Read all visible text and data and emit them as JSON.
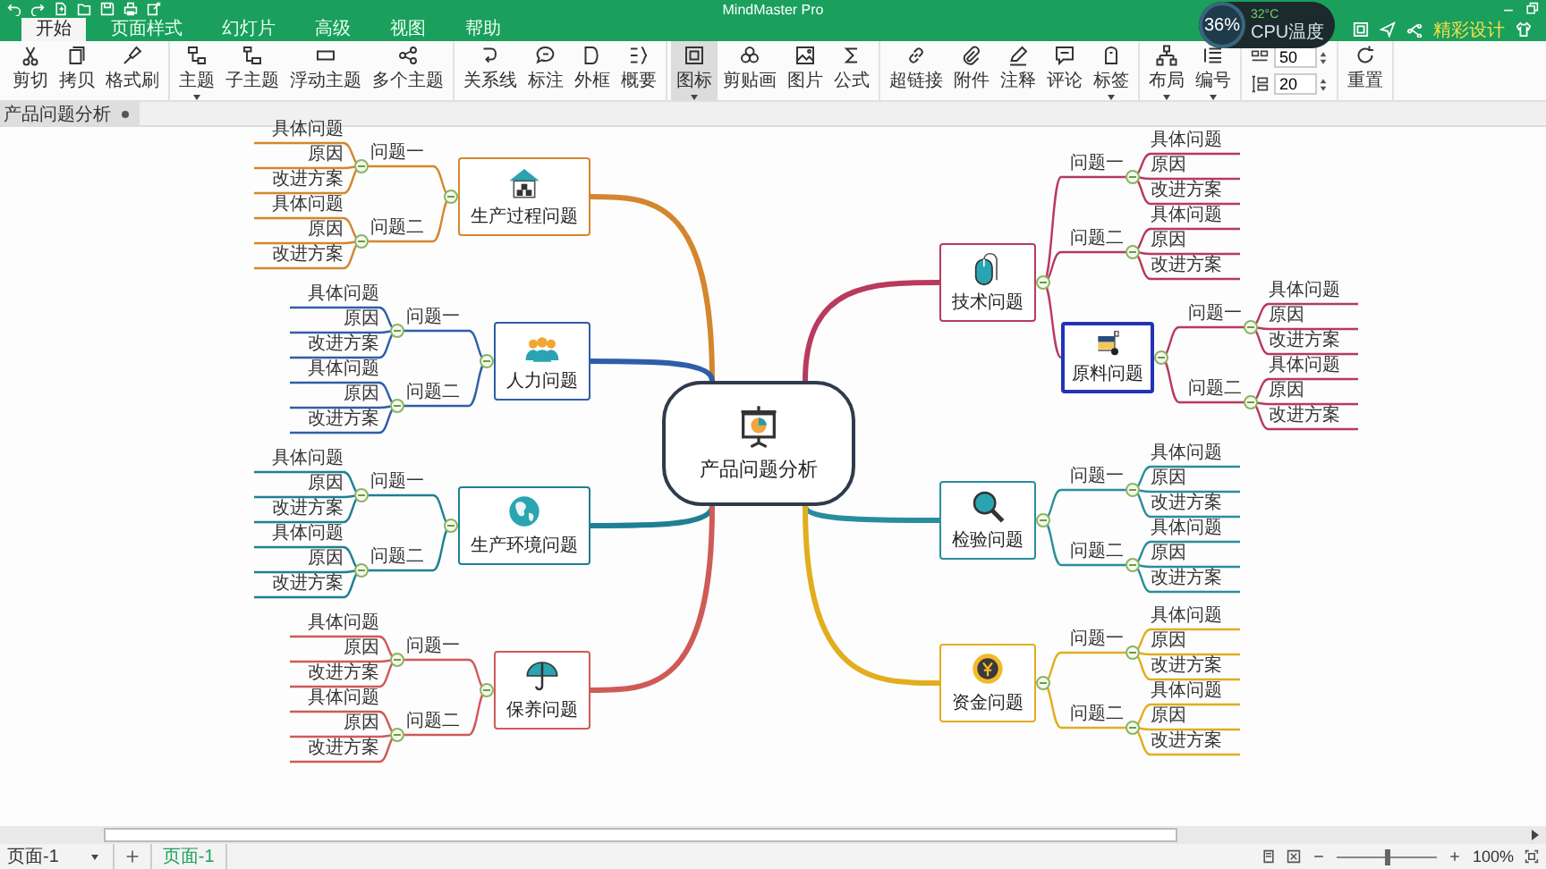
{
  "window": {
    "title": "MindMaster Pro"
  },
  "cpu_widget": {
    "usage": "36%",
    "temperature": "32°C",
    "label": "CPU温度"
  },
  "account": {
    "label": "精彩设计"
  },
  "menu_tabs": [
    {
      "label": "开始",
      "selected": true
    },
    {
      "label": "页面样式",
      "selected": false
    },
    {
      "label": "幻灯片",
      "selected": false
    },
    {
      "label": "高级",
      "selected": false
    },
    {
      "label": "视图",
      "selected": false
    },
    {
      "label": "帮助",
      "selected": false
    }
  ],
  "toolbar": [
    {
      "kind": "buttons",
      "items": [
        {
          "label": "剪切",
          "dropdown": false,
          "selected": false
        },
        {
          "label": "拷贝",
          "dropdown": false,
          "selected": false
        },
        {
          "label": "格式刷",
          "dropdown": false,
          "selected": false
        }
      ]
    },
    {
      "kind": "buttons",
      "items": [
        {
          "label": "主题",
          "dropdown": true,
          "selected": false
        },
        {
          "label": "子主题",
          "dropdown": false,
          "selected": false
        },
        {
          "label": "浮动主题",
          "dropdown": false,
          "selected": false
        },
        {
          "label": "多个主题",
          "dropdown": false,
          "selected": false
        }
      ]
    },
    {
      "kind": "buttons",
      "items": [
        {
          "label": "关系线",
          "dropdown": false,
          "selected": false
        },
        {
          "label": "标注",
          "dropdown": false,
          "selected": false
        },
        {
          "label": "外框",
          "dropdown": false,
          "selected": false
        },
        {
          "label": "概要",
          "dropdown": false,
          "selected": false
        }
      ]
    },
    {
      "kind": "buttons",
      "items": [
        {
          "label": "图标",
          "dropdown": true,
          "selected": true
        },
        {
          "label": "剪贴画",
          "dropdown": false,
          "selected": false
        },
        {
          "label": "图片",
          "dropdown": false,
          "selected": false
        },
        {
          "label": "公式",
          "dropdown": false,
          "selected": false
        }
      ]
    },
    {
      "kind": "buttons",
      "items": [
        {
          "label": "超链接",
          "dropdown": false,
          "selected": false
        },
        {
          "label": "附件",
          "dropdown": false,
          "selected": false
        },
        {
          "label": "注释",
          "dropdown": false,
          "selected": false
        },
        {
          "label": "评论",
          "dropdown": false,
          "selected": false
        },
        {
          "label": "标签",
          "dropdown": true,
          "selected": false
        }
      ]
    },
    {
      "kind": "buttons",
      "items": [
        {
          "label": "布局",
          "dropdown": true,
          "selected": false
        },
        {
          "label": "编号",
          "dropdown": true,
          "selected": false
        }
      ]
    },
    {
      "kind": "spinners",
      "items": [
        {
          "value": "50"
        },
        {
          "value": "20"
        }
      ]
    },
    {
      "kind": "buttons",
      "items": [
        {
          "label": "重置",
          "dropdown": false,
          "selected": false
        }
      ]
    }
  ],
  "doc_tab": {
    "title": "产品问题分析",
    "modified": true
  },
  "mindmap": {
    "central": {
      "title": "产品问题分析"
    },
    "left_topics": [
      {
        "title": "生产过程问题",
        "color": "#d4862f",
        "selected": false,
        "children": [
          {
            "kind": "label",
            "title": "问题一",
            "children": [
              {
                "kind": "leaf",
                "title": "具体问题"
              },
              {
                "kind": "leaf",
                "title": "原因"
              },
              {
                "kind": "leaf",
                "title": "改进方案"
              }
            ]
          },
          {
            "kind": "label",
            "title": "问题二",
            "children": [
              {
                "kind": "leaf",
                "title": "具体问题"
              },
              {
                "kind": "leaf",
                "title": "原因"
              },
              {
                "kind": "leaf",
                "title": "改进方案"
              }
            ]
          }
        ]
      },
      {
        "title": "人力问题",
        "color": "#2f5ea8",
        "selected": false,
        "children": [
          {
            "kind": "label",
            "title": "问题一",
            "children": [
              {
                "kind": "leaf",
                "title": "具体问题"
              },
              {
                "kind": "leaf",
                "title": "原因"
              },
              {
                "kind": "leaf",
                "title": "改进方案"
              }
            ]
          },
          {
            "kind": "label",
            "title": "问题二",
            "children": [
              {
                "kind": "leaf",
                "title": "具体问题"
              },
              {
                "kind": "leaf",
                "title": "原因"
              },
              {
                "kind": "leaf",
                "title": "改进方案"
              }
            ]
          }
        ]
      },
      {
        "title": "生产环境问题",
        "color": "#1f7f93",
        "selected": false,
        "children": [
          {
            "kind": "label",
            "title": "问题一",
            "children": [
              {
                "kind": "leaf",
                "title": "具体问题"
              },
              {
                "kind": "leaf",
                "title": "原因"
              },
              {
                "kind": "leaf",
                "title": "改进方案"
              }
            ]
          },
          {
            "kind": "label",
            "title": "问题二",
            "children": [
              {
                "kind": "leaf",
                "title": "具体问题"
              },
              {
                "kind": "leaf",
                "title": "原因"
              },
              {
                "kind": "leaf",
                "title": "改进方案"
              }
            ]
          }
        ]
      },
      {
        "title": "保养问题",
        "color": "#cf5b57",
        "selected": false,
        "children": [
          {
            "kind": "label",
            "title": "问题一",
            "children": [
              {
                "kind": "leaf",
                "title": "具体问题"
              },
              {
                "kind": "leaf",
                "title": "原因"
              },
              {
                "kind": "leaf",
                "title": "改进方案"
              }
            ]
          },
          {
            "kind": "label",
            "title": "问题二",
            "children": [
              {
                "kind": "leaf",
                "title": "具体问题"
              },
              {
                "kind": "leaf",
                "title": "原因"
              },
              {
                "kind": "leaf",
                "title": "改进方案"
              }
            ]
          }
        ]
      }
    ],
    "right_topics": [
      {
        "title": "技术问题",
        "color": "#b83a5e",
        "selected": false,
        "children": [
          {
            "kind": "label",
            "title": "问题一",
            "children": [
              {
                "kind": "leaf",
                "title": "具体问题"
              },
              {
                "kind": "leaf",
                "title": "原因"
              },
              {
                "kind": "leaf",
                "title": "改进方案"
              }
            ]
          },
          {
            "kind": "label",
            "title": "问题二",
            "children": [
              {
                "kind": "leaf",
                "title": "具体问题"
              },
              {
                "kind": "leaf",
                "title": "原因"
              },
              {
                "kind": "leaf",
                "title": "改进方案"
              }
            ]
          },
          {
            "kind": "subtopic",
            "title": "原料问题",
            "selected": true,
            "children": [
              {
                "kind": "label",
                "title": "问题一",
                "children": [
                  {
                    "kind": "leaf",
                    "title": "具体问题"
                  },
                  {
                    "kind": "leaf",
                    "title": "原因"
                  },
                  {
                    "kind": "leaf",
                    "title": "改进方案"
                  }
                ]
              },
              {
                "kind": "label",
                "title": "问题二",
                "children": [
                  {
                    "kind": "leaf",
                    "title": "具体问题"
                  },
                  {
                    "kind": "leaf",
                    "title": "原因"
                  },
                  {
                    "kind": "leaf",
                    "title": "改进方案"
                  }
                ]
              }
            ]
          }
        ]
      },
      {
        "title": "检验问题",
        "color": "#2b8d9c",
        "selected": false,
        "children": [
          {
            "kind": "label",
            "title": "问题一",
            "children": [
              {
                "kind": "leaf",
                "title": "具体问题"
              },
              {
                "kind": "leaf",
                "title": "原因"
              },
              {
                "kind": "leaf",
                "title": "改进方案"
              }
            ]
          },
          {
            "kind": "label",
            "title": "问题二",
            "children": [
              {
                "kind": "leaf",
                "title": "具体问题"
              },
              {
                "kind": "leaf",
                "title": "原因"
              },
              {
                "kind": "leaf",
                "title": "改进方案"
              }
            ]
          }
        ]
      },
      {
        "title": "资金问题",
        "color": "#e2ad1e",
        "selected": false,
        "children": [
          {
            "kind": "label",
            "title": "问题一",
            "children": [
              {
                "kind": "leaf",
                "title": "具体问题"
              },
              {
                "kind": "leaf",
                "title": "原因"
              },
              {
                "kind": "leaf",
                "title": "改进方案"
              }
            ]
          },
          {
            "kind": "label",
            "title": "问题二",
            "children": [
              {
                "kind": "leaf",
                "title": "具体问题"
              },
              {
                "kind": "leaf",
                "title": "原因"
              },
              {
                "kind": "leaf",
                "title": "改进方案"
              }
            ]
          }
        ]
      }
    ]
  },
  "status_bar": {
    "page_select": "页面-1",
    "pages": [
      {
        "label": "页面-1",
        "selected": true
      }
    ],
    "zoom": {
      "level": 0.5,
      "reading": "100%"
    }
  }
}
